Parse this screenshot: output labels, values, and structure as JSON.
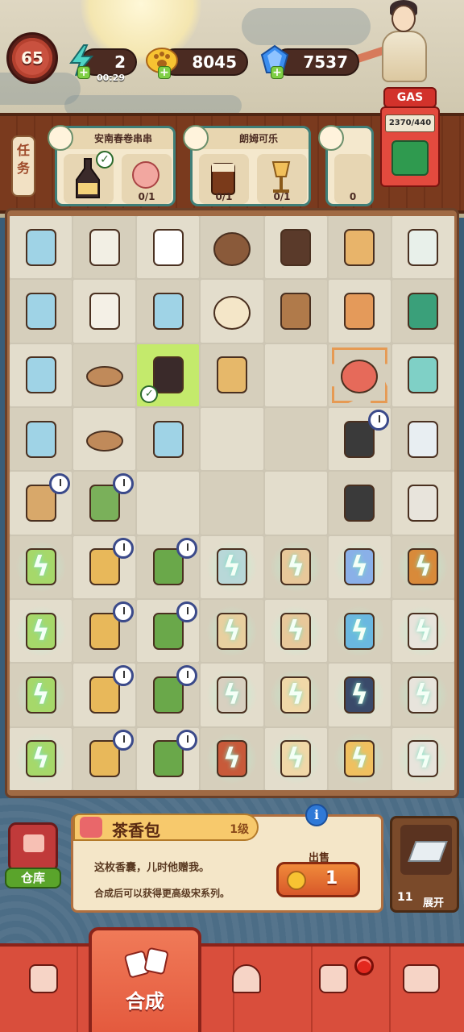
{
  "player": {
    "level": "65"
  },
  "resources": {
    "energy": "2",
    "energy_timer": "00:29",
    "coins": "8045",
    "gems": "7537"
  },
  "tasks_tab": "任\n务",
  "orders": [
    {
      "name": "安南春卷串串",
      "items": [
        {
          "count": "",
          "done": true
        },
        {
          "count": "0/1"
        }
      ]
    },
    {
      "name": "朗姆可乐",
      "items": [
        {
          "count": "0/1"
        },
        {
          "count": "0/1"
        }
      ]
    },
    {
      "name": "",
      "items": [
        {
          "count": "0"
        }
      ]
    }
  ],
  "gas": {
    "label": "GAS",
    "value": "2370/440"
  },
  "info": {
    "item_name": "茶香包",
    "item_level": "1级",
    "desc_line1": "这枚香囊，儿时他赠我。",
    "desc_line2": "合成后可以获得更高级宋系列。",
    "sell_label": "出售",
    "sell_price": "1"
  },
  "storage": {
    "label": "仓库"
  },
  "expand": {
    "count": "11",
    "label": "展开"
  },
  "nav": {
    "merge_label": "合成"
  },
  "board_rows": [
    [
      "drink",
      "calendar",
      "chef-hat",
      "noodle-plate",
      "seaweed",
      "pizza",
      "glue"
    ],
    [
      "drink",
      "coffee-bag",
      "drink",
      "bun",
      "milk-tea",
      "shrimp",
      "scissors"
    ],
    [
      "drink",
      "tea-cake",
      "sauce-bottle",
      "gift-box",
      "empty",
      "sachet",
      "jar"
    ],
    [
      "drink",
      "tea-cake",
      "drink",
      "empty",
      "empty",
      "ink-bottle",
      "bottles"
    ],
    [
      "cart",
      "scooter",
      "empty",
      "empty",
      "empty",
      "ink-bottle",
      "printer"
    ],
    [
      "bush",
      "drone",
      "tree",
      "fridge",
      "shelf",
      "notebook",
      "pot"
    ],
    [
      "bush",
      "drone",
      "tree",
      "noodle-stand",
      "shelf",
      "scroll",
      "printer"
    ],
    [
      "bush",
      "drone",
      "tree",
      "soup-pot",
      "counter",
      "lantern",
      "printer"
    ],
    [
      "bush",
      "drone",
      "tree",
      "hotpot",
      "counter",
      "basket",
      "printer"
    ]
  ]
}
